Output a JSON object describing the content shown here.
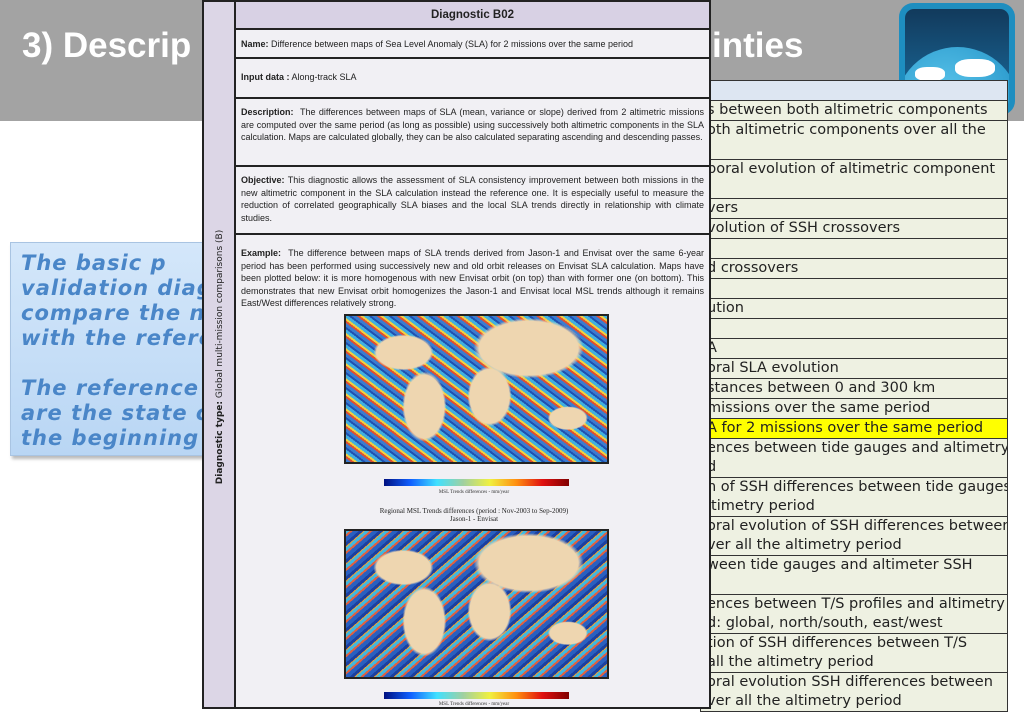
{
  "slide": {
    "title_left": "3) Descrip",
    "title_right": "inties",
    "box_lines": [
      "The basic p",
      "validation diag",
      "compare the ne",
      "with the referer",
      "",
      "The reference a",
      "are the state o",
      "the beginning o"
    ]
  },
  "table": {
    "rows": [
      {
        "lines": [
          "s between both altimetric components"
        ]
      },
      {
        "lines": [
          "oth altimetric components over all the",
          ""
        ]
      },
      {
        "lines": [
          "poral evolution of altimetric component",
          ""
        ]
      },
      {
        "lines": [
          "vers"
        ]
      },
      {
        "lines": [
          "volution of SSH crossovers"
        ]
      },
      {
        "lines": [
          ""
        ]
      },
      {
        "lines": [
          "d crossovers"
        ]
      },
      {
        "lines": [
          ""
        ]
      },
      {
        "lines": [
          "ution"
        ]
      },
      {
        "lines": [
          ""
        ]
      },
      {
        "lines": [
          "A"
        ]
      },
      {
        "lines": [
          "oral SLA evolution"
        ]
      },
      {
        "lines": [
          "stances between 0 and 300 km"
        ]
      },
      {
        "lines": [
          "missions over the same period"
        ]
      },
      {
        "lines": [
          "A for 2 missions over the same period"
        ],
        "highlight": true
      },
      {
        "lines": [
          "ences between tide gauges and altimetry",
          "d"
        ]
      },
      {
        "lines": [
          "n of SSH differences between tide gauges",
          "ltimetry period"
        ]
      },
      {
        "lines": [
          "oral evolution of SSH differences between",
          "ver all the altimetry period"
        ]
      },
      {
        "lines": [
          "ween tide gauges and altimeter SSH",
          ""
        ]
      },
      {
        "lines": [
          "ences between T/S profiles and altimetry",
          "d: global, north/south, east/west"
        ]
      },
      {
        "lines": [
          "tion of SSH differences between T/S",
          "all the altimetry period"
        ]
      },
      {
        "lines": [
          "oral evolution SSH differences between",
          "ver all the altimetry period"
        ]
      }
    ],
    "highlight_color": "#ffff00"
  },
  "doc": {
    "title": "Diagnostic  B02",
    "type_label": "Diagnostic type:",
    "type_value": "Global multi-mission comparisons (B)",
    "name_label": "Name:",
    "name": "Difference between maps of Sea Level Anomaly (SLA) for 2 missions over the same period",
    "input_label": "Input data :",
    "input": "Along-track SLA",
    "description_label": "Description:",
    "description": "The differences between maps of SLA (mean, variance or slope) derived from 2 altimetric missions are computed over the same period (as long as possible) using successively both altimetric components in the SLA calculation. Maps are calculated globally, they can be also calculated separating ascending and descending passes.",
    "objective_label": "Objective:",
    "objective": "This diagnostic allows the assessment of SLA consistency improvement between both missions in the new altimetric component in the SLA calculation instead the reference one.  It is especially useful to measure the reduction of correlated geographically SLA biases and the local SLA trends directly in relationship with climate studies.",
    "example_label": "Example:",
    "example": "The difference between maps of SLA trends derived from Jason-1 and Envisat over the same 6-year period has been performed using successively new and old orbit releases on Envisat SLA calculation. Maps have been plotted below: it is more homogenous with new Envisat orbit (on top) than with former one (on bottom). This demonstrates that new Envisat orbit homogenizes the Jason-1 and Envisat local MSL trends although it remains East/West differences relatively strong.",
    "colorbar_label": "MSL Trends differences - mm/year",
    "map2_title": "Regional MSL Trends differences (period : Nov-2003 to Sep-2009)",
    "map2_subtitle": "Jason-1 - Envisat"
  }
}
